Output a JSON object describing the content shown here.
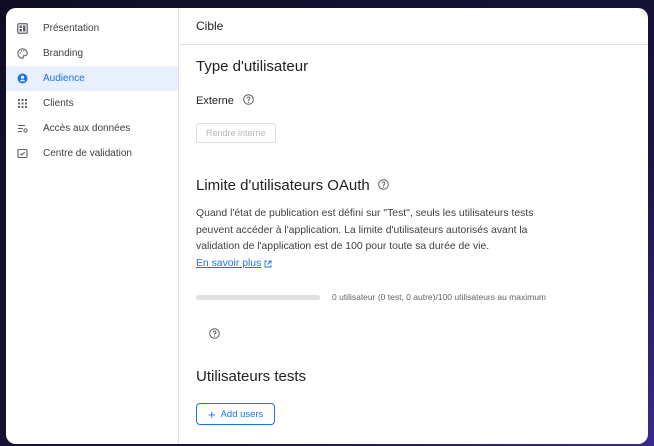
{
  "sidebar": {
    "items": [
      {
        "label": "Présentation",
        "icon": "dashboard-icon",
        "active": false
      },
      {
        "label": "Branding",
        "icon": "palette-icon",
        "active": false
      },
      {
        "label": "Audience",
        "icon": "person-icon",
        "active": true
      },
      {
        "label": "Clients",
        "icon": "grid-icon",
        "active": false
      },
      {
        "label": "Accès aux données",
        "icon": "data-access-icon",
        "active": false
      },
      {
        "label": "Centre de validation",
        "icon": "verification-icon",
        "active": false
      }
    ]
  },
  "header": {
    "title": "Cible"
  },
  "user_type": {
    "heading": "Type d'utilisateur",
    "value": "Externe",
    "make_internal_label": "Rendre interne"
  },
  "oauth_limit": {
    "heading": "Limite d'utilisateurs OAuth",
    "description": "Quand l'état de publication est défini sur \"Test\", seuls les utilisateurs tests peuvent accéder à l'application. La limite d'utilisateurs autorisés avant la validation de l'application est de 100 pour toute sa durée de vie.",
    "learn_more": "En savoir plus",
    "usage_fraction": 0,
    "usage_text": "0 utilisateur (0 test, 0 autre)/100 utilisateurs au maximum"
  },
  "test_users": {
    "heading": "Utilisateurs tests",
    "add_label": "Add users"
  },
  "colors": {
    "accent": "#1a73e8",
    "active_bg": "#e8f0fe",
    "border": "#e0e0e0"
  }
}
